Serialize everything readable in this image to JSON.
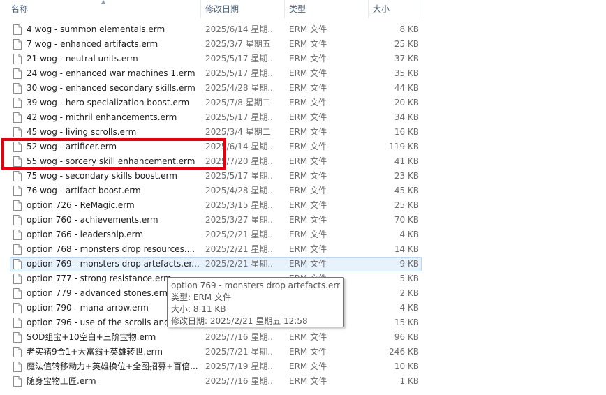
{
  "columns": {
    "name": "名称",
    "date": "修改日期",
    "type": "类型",
    "size": "大小"
  },
  "rows": [
    {
      "name": "4 wog - summon elementals.erm",
      "date": "2025/6/14 星期...",
      "type": "ERM 文件",
      "size": "8 KB"
    },
    {
      "name": "7 wog - enhanced artifacts.erm",
      "date": "2025/3/7 星期五 ...",
      "type": "ERM 文件",
      "size": "25 KB"
    },
    {
      "name": "21 wog - neutral units.erm",
      "date": "2025/5/17 星期...",
      "type": "ERM 文件",
      "size": "37 KB"
    },
    {
      "name": "24 wog - enhanced war machines 1.erm",
      "date": "2025/5/17 星期...",
      "type": "ERM 文件",
      "size": "35 KB"
    },
    {
      "name": "30 wog - enhanced secondary skills.erm",
      "date": "2025/4/28 星期...",
      "type": "ERM 文件",
      "size": "44 KB"
    },
    {
      "name": "39 wog - hero specialization boost.erm",
      "date": "2025/7/8 星期二 ...",
      "type": "ERM 文件",
      "size": "20 KB"
    },
    {
      "name": "42 wog - mithril enhancements.erm",
      "date": "2025/5/17 星期...",
      "type": "ERM 文件",
      "size": "34 KB"
    },
    {
      "name": "45 wog - living scrolls.erm",
      "date": "2025/3/4 星期二 ...",
      "type": "ERM 文件",
      "size": "16 KB"
    },
    {
      "name": "52 wog - artificer.erm",
      "date": "2025/6/14 星期...",
      "type": "ERM 文件",
      "size": "119 KB"
    },
    {
      "name": "55 wog - sorcery skill enhancement.erm",
      "date": "2025/7/20 星期...",
      "type": "ERM 文件",
      "size": "41 KB"
    },
    {
      "name": "75 wog - secondary skills boost.erm",
      "date": "2025/5/17 星期...",
      "type": "ERM 文件",
      "size": "23 KB"
    },
    {
      "name": "76 wog - artifact boost.erm",
      "date": "2025/4/28 星期...",
      "type": "ERM 文件",
      "size": "45 KB"
    },
    {
      "name": "option 726 - ReMagic.erm",
      "date": "2025/3/15 星期...",
      "type": "ERM 文件",
      "size": "25 KB"
    },
    {
      "name": "option 760 - achievements.erm",
      "date": "2025/3/27 星期...",
      "type": "ERM 文件",
      "size": "70 KB"
    },
    {
      "name": "option 766 - leadership.erm",
      "date": "2025/2/21 星期...",
      "type": "ERM 文件",
      "size": "4 KB"
    },
    {
      "name": "option 768 - monsters drop resources....",
      "date": "2025/2/21 星期...",
      "type": "ERM 文件",
      "size": "14 KB"
    },
    {
      "name": "option 769 - monsters drop artefacts.er...",
      "date": "2025/2/21 星期...",
      "type": "ERM 文件",
      "size": "9 KB"
    },
    {
      "name": "option 777 - strong resistance.erm",
      "date": "",
      "type": "ERM 文件",
      "size": "5 KB"
    },
    {
      "name": "option 779 - advanced stones.erm",
      "date": "",
      "type": "ERM 文件",
      "size": "2 KB"
    },
    {
      "name": "option 790 - mana arrow.erm",
      "date": "",
      "type": "ERM 文件",
      "size": "4 KB"
    },
    {
      "name": "option 796 - use of the scrolls and",
      "date": "",
      "type": "ERM 文件",
      "size": "15 KB"
    },
    {
      "name": "SOD组宝+10空白+三阶宝物.erm",
      "date": "2025/7/16 星期...",
      "type": "ERM 文件",
      "size": "96 KB"
    },
    {
      "name": "老实猪9合1+大富翁+英雄转世.erm",
      "date": "2025/7/21 星期...",
      "type": "ERM 文件",
      "size": "246 KB"
    },
    {
      "name": "魔法值转移动力+英雄换位+全图招募+百倍...",
      "date": "2025/7/19 星期...",
      "type": "ERM 文件",
      "size": "10 KB"
    },
    {
      "name": "随身宝物工匠.erm",
      "date": "2025/7/16 星期...",
      "type": "ERM 文件",
      "size": "1 KB"
    }
  ],
  "tooltip": {
    "filename": "option 769 - monsters drop artefacts.erm",
    "type_line": "类型: ERM 文件",
    "size_line": "大小: 8.11 KB",
    "date_line": "修改日期: 2025/2/21 星期五 12:58"
  },
  "colors": {
    "highlight_box": "#e4000f",
    "hover_row": "#e8f2fd",
    "header_text": "#4c607a"
  }
}
